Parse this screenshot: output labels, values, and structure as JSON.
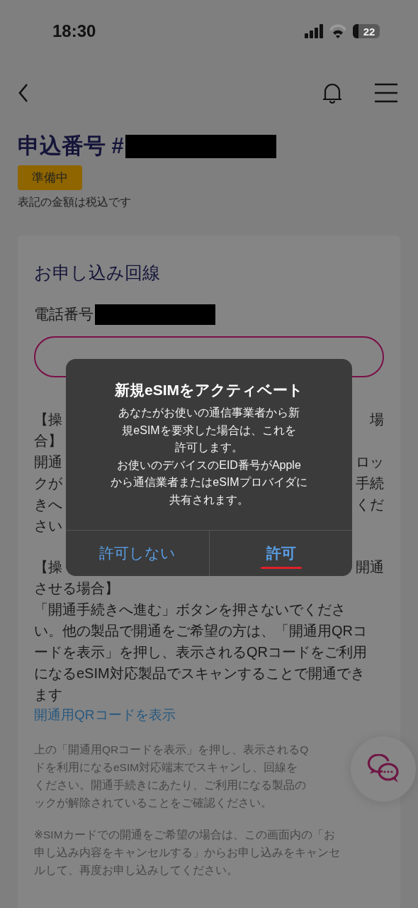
{
  "status_bar": {
    "time": "18:30",
    "battery": "22"
  },
  "header": {
    "title": "申込番号 #",
    "status_badge": "準備中",
    "tax_note": "表記の金額は税込です"
  },
  "card": {
    "heading": "お申し込み回線",
    "phone_label": "電話番号",
    "paragraphs": [
      [
        [
          "【操",
          "場"
        ],
        [
          "合】"
        ],
        [
          "開通",
          "ロッ"
        ],
        [
          "クが",
          "手続"
        ],
        [
          "きへ",
          "くだ"
        ],
        [
          "さい"
        ]
      ],
      [
        [
          "【操",
          "開通"
        ],
        [
          "させる場合】"
        ],
        [
          "「開通手続きへ進む」ボタンを押さないでくださ"
        ],
        [
          "い。他の製品で開通をご希望の方は、「開通用QRコ"
        ],
        [
          "ードを表示」を押し、表示されるQRコードをご利用"
        ],
        [
          "になるeSIM対応製品でスキャンすることで開通でき"
        ],
        [
          "ます"
        ]
      ]
    ],
    "link": "開通用QRコードを表示",
    "notes": [
      [
        "上の「開通用QRコードを表示」を押し、表示されるQ",
        "ドを利用になるeSIM対応端末でスキャンし、回線を",
        "ください。開通手続きにあたり、ご利用になる製品の",
        "ックが解除されていることをご確認ください。"
      ],
      [
        "※SIMカードでの開通をご希望の場合は、この画面内の「お",
        "申し込み内容をキャンセルする」からお申し込みをキャンセ",
        "ルして、再度お申し込みしてください。"
      ]
    ]
  },
  "dialog": {
    "title": "新規eSIMをアクティベート",
    "message_lines": [
      "あなたがお使いの通信事業者から新",
      "規eSIMを要求した場合は、これを",
      "許可します。",
      "お使いのデバイスのEID番号がApple",
      "から通信業者またはeSIMプロバイダに",
      "共有されます。"
    ],
    "buttons": [
      {
        "label": "許可しない",
        "kind": "cancel",
        "underlined": false
      },
      {
        "label": "許可",
        "kind": "default",
        "underlined": true
      }
    ]
  }
}
